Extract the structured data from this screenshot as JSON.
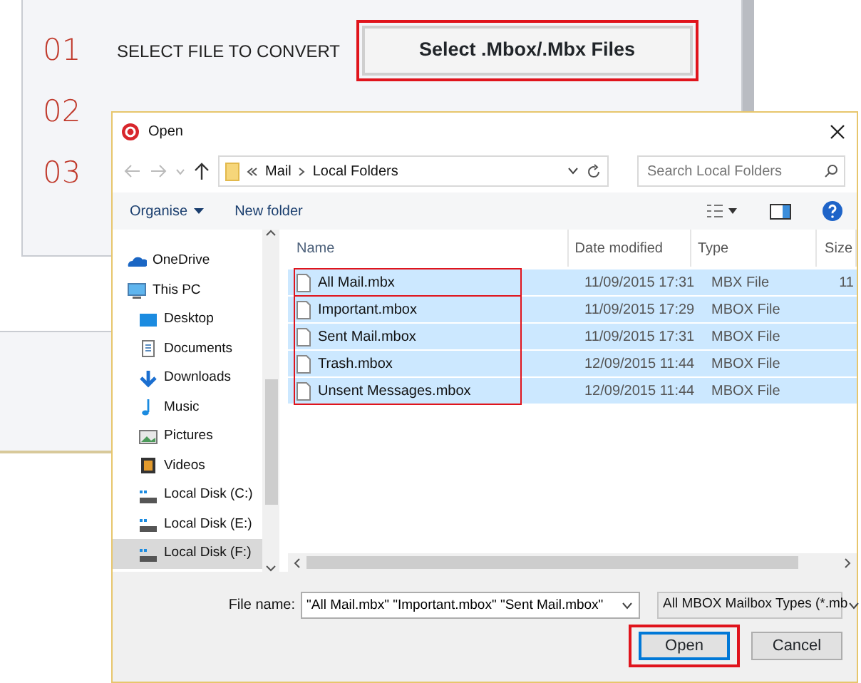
{
  "app": {
    "steps": [
      {
        "number": "01",
        "label": "SELECT FILE TO CONVERT",
        "button": {
          "label": "Select .Mbox/.Mbx Files",
          "outlined": true
        }
      },
      {
        "number": "02"
      },
      {
        "number": "03"
      }
    ]
  },
  "dialog": {
    "title": "Open",
    "breadcrumb": [
      "Mail",
      "Local Folders"
    ],
    "search": {
      "placeholder": "Search Local Folders"
    },
    "toolbar": [
      "Organise",
      "New folder"
    ],
    "nav": [
      {
        "label": "OneDrive",
        "kind": "cloud",
        "selected": false
      },
      {
        "label": "This PC",
        "kind": "pc",
        "selected": false,
        "children": [
          {
            "label": "Desktop",
            "kind": "desktop",
            "selected": false
          },
          {
            "label": "Documents",
            "kind": "documents",
            "selected": false
          },
          {
            "label": "Downloads",
            "kind": "downloads",
            "selected": false
          },
          {
            "label": "Music",
            "kind": "music",
            "selected": false
          },
          {
            "label": "Pictures",
            "kind": "pictures",
            "selected": false
          },
          {
            "label": "Videos",
            "kind": "videos",
            "selected": false
          },
          {
            "label": "Local Disk (C:)",
            "kind": "disk",
            "selected": false
          },
          {
            "label": "Local Disk (E:)",
            "kind": "disk",
            "selected": false
          },
          {
            "label": "Local Disk (F:)",
            "kind": "disk",
            "selected": true
          }
        ]
      }
    ],
    "columns": [
      "Name",
      "Date modified",
      "Type",
      "Size"
    ],
    "row_groups": [
      {
        "outlined": true,
        "rows": [
          {
            "name": "All Mail.mbx",
            "date": "11/09/2015 17:31",
            "type": "MBX File",
            "size": "11",
            "selected": true
          }
        ]
      },
      {
        "outlined": true,
        "rows": [
          {
            "name": "Important.mbox",
            "date": "11/09/2015 17:29",
            "type": "MBOX File",
            "selected": true
          },
          {
            "name": "Sent Mail.mbox",
            "date": "11/09/2015 17:31",
            "type": "MBOX File",
            "selected": true
          },
          {
            "name": "Trash.mbox",
            "date": "12/09/2015 11:44",
            "type": "MBOX File",
            "selected": true
          },
          {
            "name": "Unsent Messages.mbox",
            "date": "12/09/2015 11:44",
            "type": "MBOX File",
            "selected": true
          }
        ]
      }
    ],
    "file_name": {
      "label": "File name:",
      "value": "\"All Mail.mbx\" \"Important.mbox\" \"Sent Mail.mbox\""
    },
    "file_type": "All MBOX Mailbox Types (*.mb",
    "buttons": [
      {
        "label": "Open",
        "default": true,
        "outlined": true
      },
      {
        "label": "Cancel",
        "default": false,
        "outlined": false
      }
    ]
  }
}
